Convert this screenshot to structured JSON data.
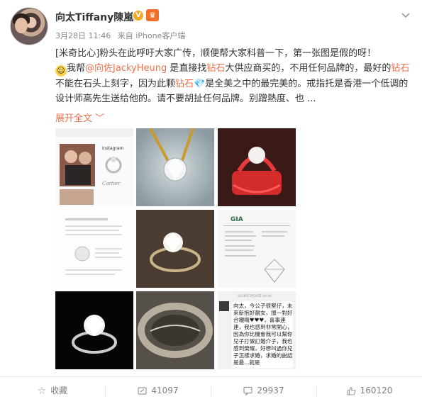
{
  "post": {
    "author": "向太Tiffany陳嵐",
    "verified_badge": "V",
    "level_badge": "♛",
    "date": "3月28日 11:46",
    "source": "来自 iPhone客户端",
    "menu_icon": "chevron-down-icon",
    "text": {
      "p1": "[米奇比心]粉头在此呼吁大家广传，顺便帮大家科普一下，第一张图是假的呀！",
      "p2a": "我帮",
      "mention": "@向佐JackyHeung",
      "p2b": " 是直接找",
      "kw1": "钻石",
      "p2c": "大供应商买的，不用任何品牌的，最好的",
      "kw2": "钻石",
      "p2d": "不能在石头上刻字，因为此颗",
      "kw3": "钻石",
      "p2e": "是全美之中的最完美的。戒指托是香港一个低调的设计师高先生送给他的。请不要胡扯任何品牌。别蹭熱度、也 ..."
    },
    "expand_label": "展开全文 ﹀"
  },
  "images": [
    {
      "name": "instagram-screenshot",
      "text_top": "Instagram",
      "text_brand": "Cartier"
    },
    {
      "name": "diamond-tweezers"
    },
    {
      "name": "red-wax-ring-setting"
    },
    {
      "name": "document-page"
    },
    {
      "name": "diamond-ring-dark"
    },
    {
      "name": "gia-certificate",
      "text_top": "GIA"
    },
    {
      "name": "ring-black-background"
    },
    {
      "name": "ring-band-closeup"
    },
    {
      "name": "chat-screenshot",
      "text_top": "2018年3月28日 09:46",
      "text_body": "向太，今公子很堅仔，未來新抱好靚女，搵一對好合襯嘅♥♥♥，喜事連連，我也感到非常開心，因為你比機會我可以幫你兒子打做訂婚介子，我也感到榮耀，好想叫過你兒子怎樣求婚，求婚的說話是最...就是"
    }
  ],
  "actions": {
    "favorite": {
      "label": "收藏",
      "icon": "star-icon"
    },
    "repost": {
      "label": "41097",
      "icon": "repost-icon"
    },
    "comment": {
      "label": "29937",
      "icon": "comment-icon"
    },
    "like": {
      "label": "160120",
      "icon": "thumbs-up-icon"
    }
  },
  "colors": {
    "accent": "#eb7350",
    "badge_v": "#f5a623",
    "badge_level": "#f46f26",
    "meta": "#888888"
  }
}
